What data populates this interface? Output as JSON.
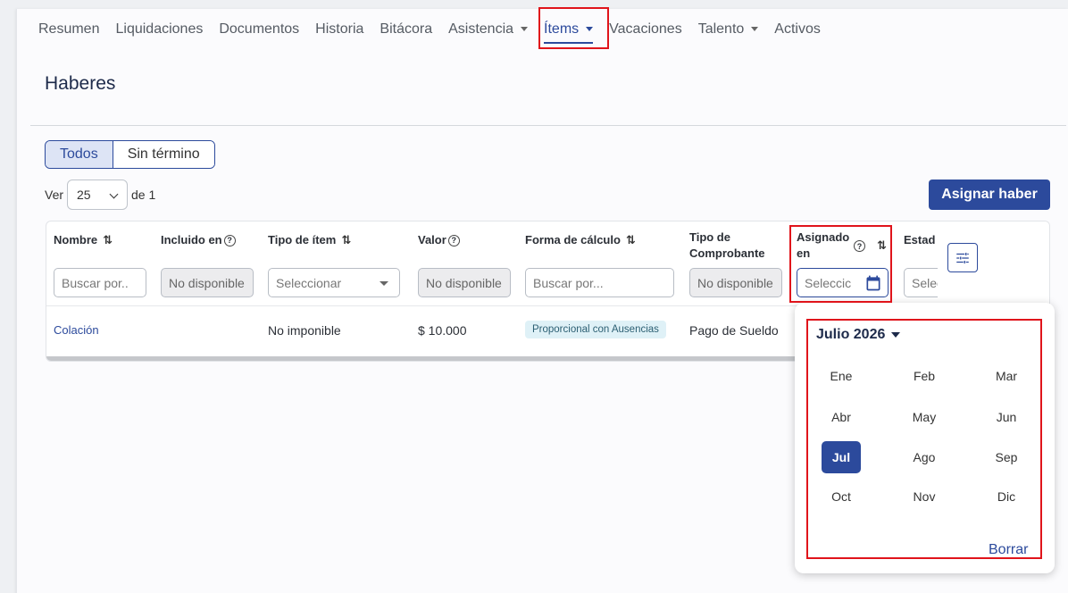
{
  "tabs": [
    {
      "label": "Resumen",
      "dropdown": false
    },
    {
      "label": "Liquidaciones",
      "dropdown": false
    },
    {
      "label": "Documentos",
      "dropdown": false
    },
    {
      "label": "Historia",
      "dropdown": false
    },
    {
      "label": "Bitácora",
      "dropdown": false
    },
    {
      "label": "Asistencia",
      "dropdown": true
    },
    {
      "label": "Ítems",
      "dropdown": true,
      "active": true
    },
    {
      "label": "Vacaciones",
      "dropdown": false
    },
    {
      "label": "Talento",
      "dropdown": true
    },
    {
      "label": "Activos",
      "dropdown": false
    }
  ],
  "page_title": "Haberes",
  "segment": {
    "all": "Todos",
    "no_end": "Sin término"
  },
  "pager": {
    "ver": "Ver",
    "page_size": "25",
    "of": "de 1"
  },
  "assign_button": "Asignar haber",
  "columns": {
    "nombre": "Nombre",
    "incluido": "Incluido en",
    "tipo_item": "Tipo de ítem",
    "valor": "Valor",
    "forma": "Forma de cálculo",
    "tipo_comp": "Tipo de Comprobante",
    "asignado": "Asignado en",
    "estado": "Estad"
  },
  "filters": {
    "nombre": "Buscar por..",
    "incluido": "No disponible",
    "tipo_item": "Seleccionar",
    "valor": "No disponible",
    "forma": "Buscar por...",
    "tipo_comp": "No disponible",
    "asignado": "Seleccic",
    "estado": "Selec"
  },
  "rows": [
    {
      "nombre": "Colación",
      "tipo_item": "No imponible",
      "valor": "$ 10.000",
      "forma": "Proporcional con Ausencias",
      "tipo_comp": "Pago de Sueldo"
    }
  ],
  "picker": {
    "title": "Julio 2026",
    "months": [
      "Ene",
      "Feb",
      "Mar",
      "Abr",
      "May",
      "Jun",
      "Jul",
      "Ago",
      "Sep",
      "Oct",
      "Nov",
      "Dic"
    ],
    "selected_index": 6,
    "clear": "Borrar"
  },
  "colors": {
    "primary": "#2c4a9c",
    "highlight": "#e0141b"
  }
}
